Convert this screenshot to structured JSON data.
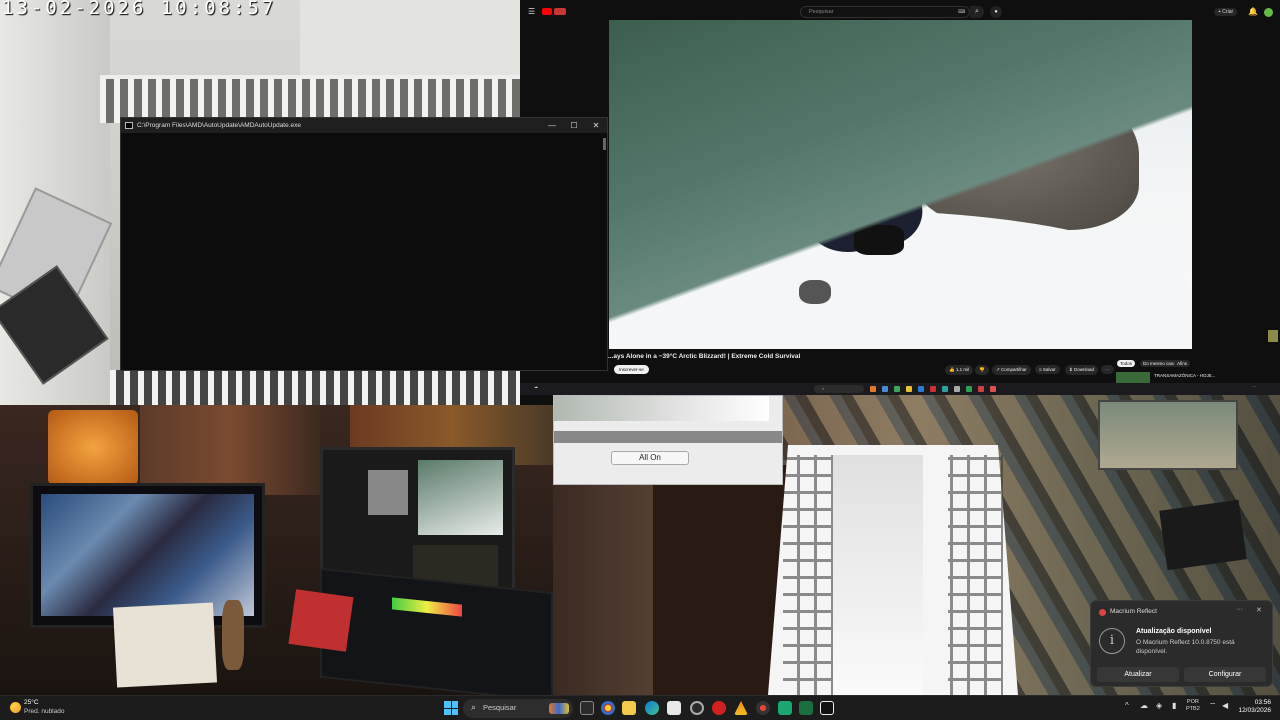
{
  "camera": {
    "timestamp": "13-02-2026  10:08:57"
  },
  "console": {
    "title": "C:\\Program Files\\AMD\\AutoUpdate\\AMDAutoUpdate.exe",
    "minimize": "—",
    "maximize": "☐",
    "close": "✕"
  },
  "youtube": {
    "search_placeholder": "Pesquisar",
    "create_label": "+ Criar",
    "video_title": "...ays Alone in a −39°C Arctic Blizzard! | Extreme Cold Survival",
    "subscribe_label": "Inscrever-se",
    "actions": {
      "like": "1,1 mil",
      "share": "Compartilhar",
      "save": "Salvar",
      "download": "Download"
    },
    "chips": {
      "all": "Todos",
      "channel": "Do mesmo canal",
      "related": "Afins"
    },
    "recommended_title": "TRANSAMAZÔNICA - HOJE..."
  },
  "remote_dialog": {
    "all_on_label": "All On"
  },
  "notification": {
    "app": "Macrium Reflect",
    "title": "Atualização disponível",
    "body": "O Macrium Reflect 10.0.8750 está disponível.",
    "primary": "Atualizar",
    "secondary": "Configurar"
  },
  "taskbar": {
    "weather_temp": "25°C",
    "weather_desc": "Pred. nublado",
    "search_label": "Pesquisar",
    "lang_top": "POR",
    "lang_bottom": "PTB2",
    "time": "03:56",
    "date": "12/03/2026"
  },
  "colors": {
    "taskbar": "#1c1c1c",
    "accent": "#4cc2ff",
    "youtube_red": "#ff0000",
    "notification_bg": "#2b2b2b"
  }
}
